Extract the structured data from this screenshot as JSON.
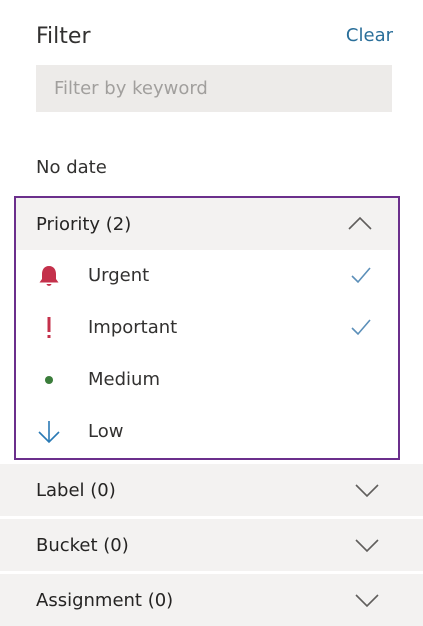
{
  "header": {
    "title": "Filter",
    "clear_label": "Clear"
  },
  "search": {
    "placeholder": "Filter by keyword",
    "value": ""
  },
  "due": {
    "label": "No date"
  },
  "priority": {
    "header_label": "Priority (2)",
    "expanded": true,
    "options": [
      {
        "label": "Urgent",
        "icon": "bell-icon",
        "icon_color": "#c4314b",
        "checked": true
      },
      {
        "label": "Important",
        "icon": "exclamation-icon",
        "icon_color": "#c4314b",
        "checked": true
      },
      {
        "label": "Medium",
        "icon": "dot-icon",
        "icon_color": "#3b7d3b",
        "checked": false
      },
      {
        "label": "Low",
        "icon": "arrow-down-icon",
        "icon_color": "#2a7ab5",
        "checked": false
      }
    ],
    "check_color": "#5b8fb9",
    "highlight_border_color": "#6b2f8c"
  },
  "sections": {
    "label": {
      "label": "Label (0)",
      "expanded": false
    },
    "bucket": {
      "label": "Bucket (0)",
      "expanded": false
    },
    "assignment": {
      "label": "Assignment (0)",
      "expanded": false
    }
  },
  "colors": {
    "accent": "#2a6f9a",
    "section_bg": "#f3f2f1",
    "input_bg": "#edebe9"
  }
}
